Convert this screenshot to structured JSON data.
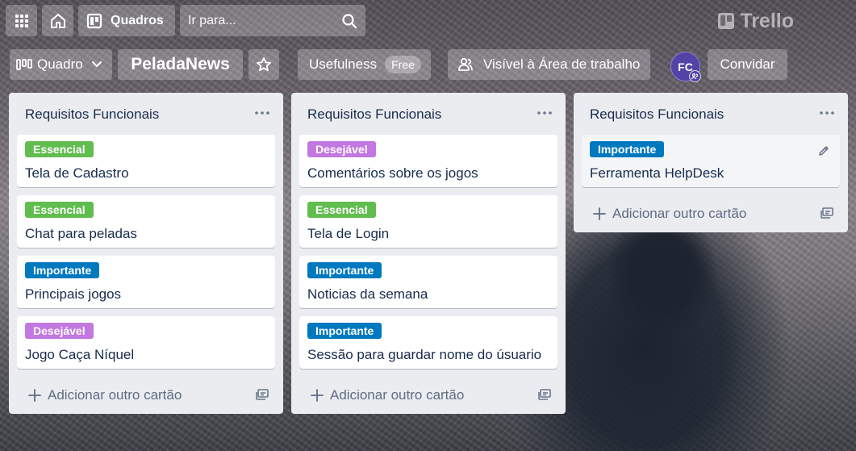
{
  "header": {
    "boards_label": "Quadros",
    "search_placeholder": "Ir para...",
    "logo_text": "Trello"
  },
  "board": {
    "view_label": "Quadro",
    "name": "PeladaNews",
    "usefulness_label": "Usefulness",
    "free_badge": "Free",
    "visibility_label": "Visível à Área de trabalho",
    "avatar_initials": "FC",
    "invite_label": "Convidar"
  },
  "label_colors": {
    "Essencial": "#61bd4f",
    "Desejável": "#c377e0",
    "Importante": "#0079bf"
  },
  "lists": [
    {
      "title": "Requisitos Funcionais",
      "cards": [
        {
          "label": "Essencial",
          "title": "Tela de Cadastro"
        },
        {
          "label": "Essencial",
          "title": "Chat para peladas"
        },
        {
          "label": "Importante",
          "title": "Principais jogos"
        },
        {
          "label": "Desejável",
          "title": "Jogo Caça Níquel"
        }
      ],
      "add_card_label": "Adicionar outro cartão"
    },
    {
      "title": "Requisitos Funcionais",
      "cards": [
        {
          "label": "Desejável",
          "title": "Comentários sobre os jogos"
        },
        {
          "label": "Essencial",
          "title": "Tela de Login"
        },
        {
          "label": "Importante",
          "title": "Noticias da semana"
        },
        {
          "label": "Importante",
          "title": "Sessão para guardar nome do úsuario"
        }
      ],
      "add_card_label": "Adicionar outro cartão"
    },
    {
      "title": "Requisitos Funcionais",
      "cards": [
        {
          "label": "Importante",
          "title": "Ferramenta HelpDesk"
        }
      ],
      "add_card_label": "Adicionar outro cartão"
    }
  ]
}
